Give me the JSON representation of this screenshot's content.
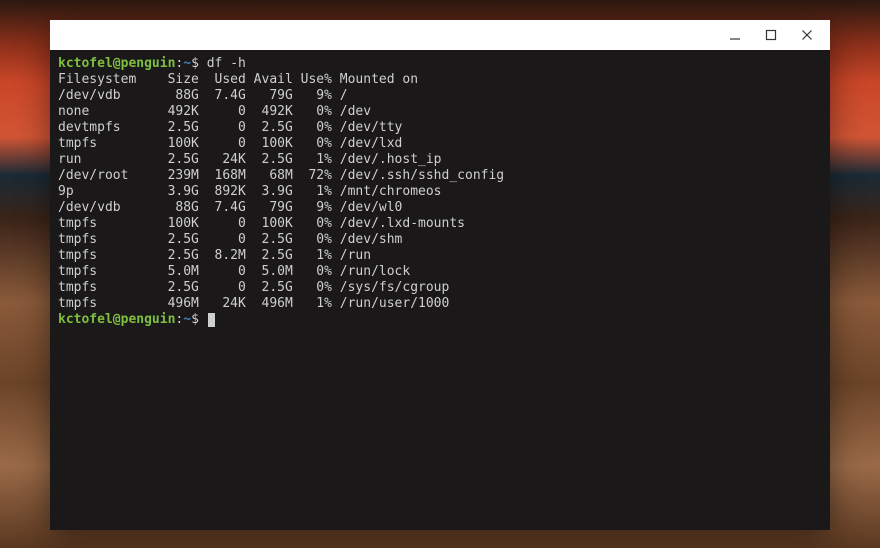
{
  "prompt": {
    "user": "kctofel@penguin",
    "sep": ":",
    "path": "~",
    "symbol": "$"
  },
  "command": "df -h",
  "header": [
    "Filesystem",
    "Size",
    "Used",
    "Avail",
    "Use%",
    "Mounted on"
  ],
  "rows": [
    {
      "fs": "/dev/vdb",
      "size": "88G",
      "used": "7.4G",
      "avail": "79G",
      "usep": "9%",
      "mount": "/"
    },
    {
      "fs": "none",
      "size": "492K",
      "used": "0",
      "avail": "492K",
      "usep": "0%",
      "mount": "/dev"
    },
    {
      "fs": "devtmpfs",
      "size": "2.5G",
      "used": "0",
      "avail": "2.5G",
      "usep": "0%",
      "mount": "/dev/tty"
    },
    {
      "fs": "tmpfs",
      "size": "100K",
      "used": "0",
      "avail": "100K",
      "usep": "0%",
      "mount": "/dev/lxd"
    },
    {
      "fs": "run",
      "size": "2.5G",
      "used": "24K",
      "avail": "2.5G",
      "usep": "1%",
      "mount": "/dev/.host_ip"
    },
    {
      "fs": "/dev/root",
      "size": "239M",
      "used": "168M",
      "avail": "68M",
      "usep": "72%",
      "mount": "/dev/.ssh/sshd_config"
    },
    {
      "fs": "9p",
      "size": "3.9G",
      "used": "892K",
      "avail": "3.9G",
      "usep": "1%",
      "mount": "/mnt/chromeos"
    },
    {
      "fs": "/dev/vdb",
      "size": "88G",
      "used": "7.4G",
      "avail": "79G",
      "usep": "9%",
      "mount": "/dev/wl0"
    },
    {
      "fs": "tmpfs",
      "size": "100K",
      "used": "0",
      "avail": "100K",
      "usep": "0%",
      "mount": "/dev/.lxd-mounts"
    },
    {
      "fs": "tmpfs",
      "size": "2.5G",
      "used": "0",
      "avail": "2.5G",
      "usep": "0%",
      "mount": "/dev/shm"
    },
    {
      "fs": "tmpfs",
      "size": "2.5G",
      "used": "8.2M",
      "avail": "2.5G",
      "usep": "1%",
      "mount": "/run"
    },
    {
      "fs": "tmpfs",
      "size": "5.0M",
      "used": "0",
      "avail": "5.0M",
      "usep": "0%",
      "mount": "/run/lock"
    },
    {
      "fs": "tmpfs",
      "size": "2.5G",
      "used": "0",
      "avail": "2.5G",
      "usep": "0%",
      "mount": "/sys/fs/cgroup"
    },
    {
      "fs": "tmpfs",
      "size": "496M",
      "used": "24K",
      "avail": "496M",
      "usep": "1%",
      "mount": "/run/user/1000"
    }
  ],
  "widths": {
    "fs": 12,
    "size": 6,
    "used": 6,
    "avail": 6,
    "usep": 5
  }
}
